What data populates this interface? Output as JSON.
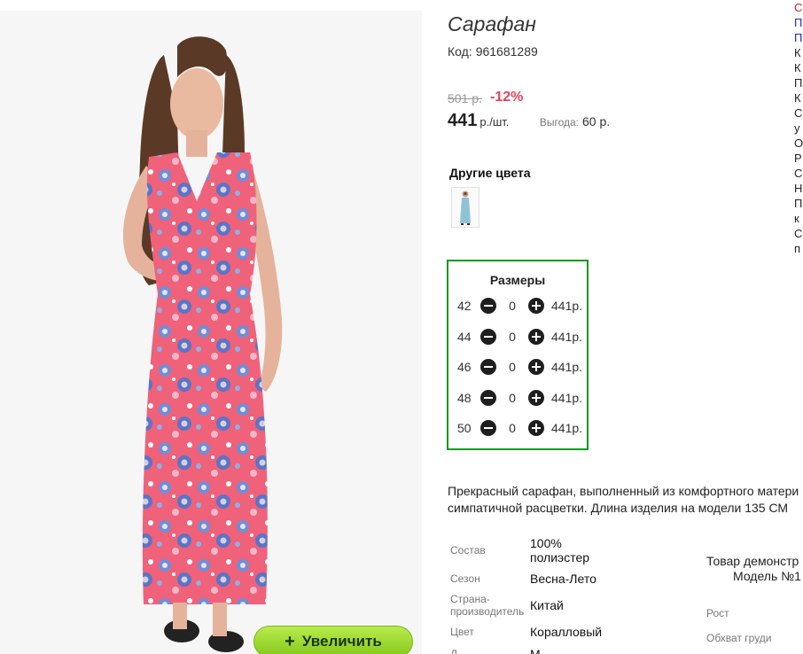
{
  "product": {
    "title": "Сарафан",
    "code_label": "Код:",
    "code_value": "961681289",
    "old_price": "501 р.",
    "discount": "-12%",
    "price": "441",
    "price_unit": "р./шт.",
    "benefit_label": "Выгода:",
    "benefit_value": "60 р."
  },
  "image": {
    "zoom_label": "Увеличить",
    "zoom_icon": "plus-icon"
  },
  "colors": {
    "heading": "Другие цвета",
    "thumbnails": [
      {
        "color": "#8ec3d6"
      }
    ]
  },
  "sizes": {
    "heading": "Размеры",
    "rows": [
      {
        "size": "42",
        "qty": "0",
        "price": "441р."
      },
      {
        "size": "44",
        "qty": "0",
        "price": "441р."
      },
      {
        "size": "46",
        "qty": "0",
        "price": "441р."
      },
      {
        "size": "48",
        "qty": "0",
        "price": "441р."
      },
      {
        "size": "50",
        "qty": "0",
        "price": "441р."
      }
    ],
    "border_color": "#119a1b"
  },
  "side_list": {
    "items": [
      "С",
      "П",
      "П",
      "К",
      "К",
      "П",
      "К",
      "С",
      "у",
      "О",
      "Р",
      "С",
      "Н",
      "П",
      "к",
      "С",
      "п"
    ]
  },
  "description": {
    "line1": "Прекрасный сарафан, выполненный из комфортного матери",
    "line2": "симпатичной расцветки. Длина изделия на модели 135 СМ"
  },
  "attributes": [
    {
      "label": "Состав",
      "value_line1": "100%",
      "value_line2": "полиэстер"
    },
    {
      "label": "Сезон",
      "value_line1": "Весна-Лето"
    },
    {
      "label_line1": "Страна-",
      "label_line2": "производитель",
      "value_line1": "Китай"
    },
    {
      "label": "Цвет",
      "value_line1": "Коралловый"
    },
    {
      "label": "Д",
      "value_line1": "М"
    }
  ],
  "demo": {
    "line1": "Товар демонстр",
    "line2": "Модель №1",
    "height_label": "Рост",
    "chest_label": "Обхват груди"
  },
  "colors_theme": {
    "discount": "#e0445c",
    "zoom_button": "#9fdc35"
  }
}
